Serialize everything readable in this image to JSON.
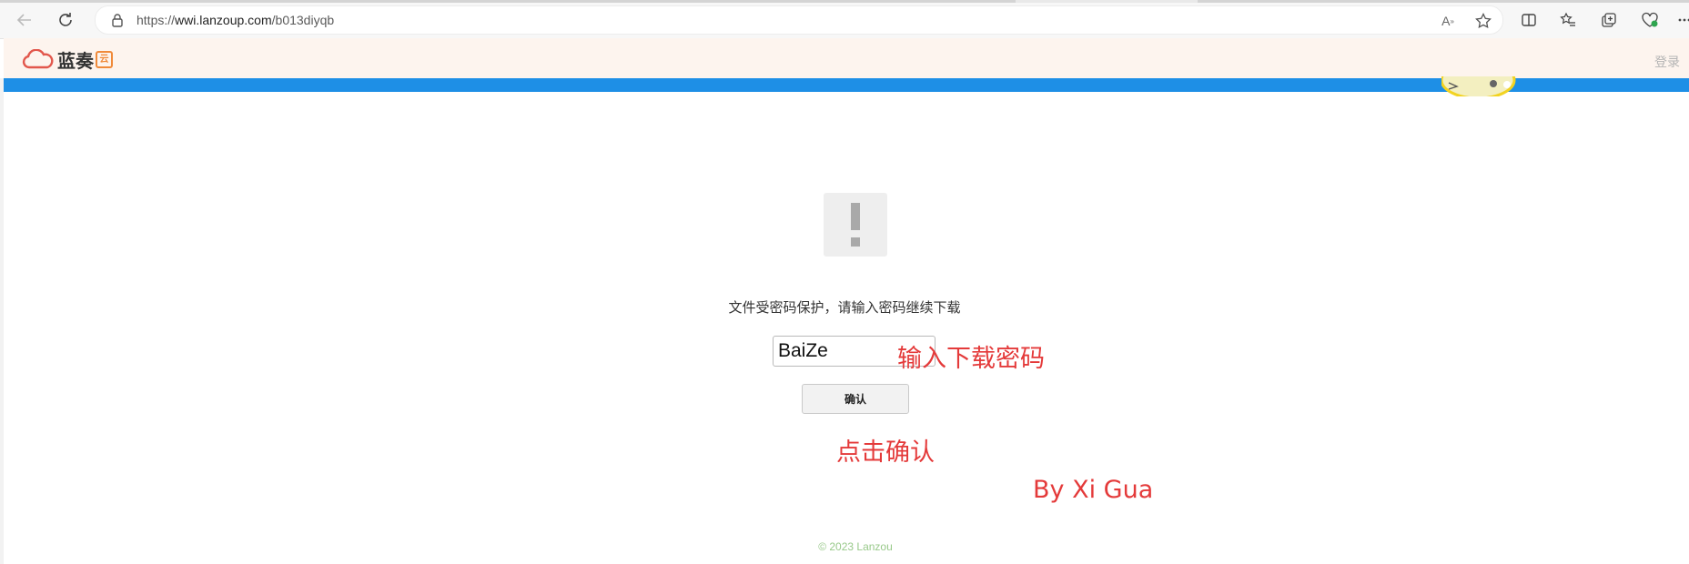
{
  "browser": {
    "url_prefix": "https://",
    "url_host": "wwi.lanzoup.com",
    "url_path": "/b013diyqb",
    "read_aloud_label": "A"
  },
  "site": {
    "logo_text": "蓝奏",
    "logo_badge": "云",
    "login_label": "登录"
  },
  "main": {
    "message": "文件受密码保护，请输入密码继续下载",
    "password_value": "BaiZe",
    "confirm_label": "确认",
    "footer": "© 2023 Lanzou"
  },
  "annotations": {
    "input_hint": "输入下载密码",
    "confirm_hint": "点击确认",
    "author": "By Xi Gua"
  },
  "colors": {
    "header_bg": "#fdf4ee",
    "stripe": "#1e8fe6",
    "annotation": "#e43a3a",
    "footer_text": "#98c98a"
  }
}
